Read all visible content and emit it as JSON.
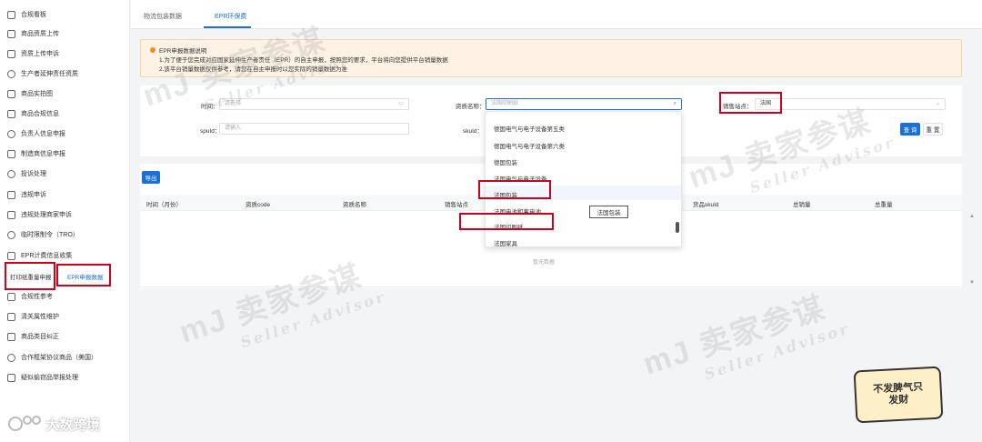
{
  "sidebar": {
    "items": [
      {
        "label": "合规看板",
        "icon": "dashboard-icon"
      },
      {
        "label": "商品资质上传",
        "icon": "upload-icon"
      },
      {
        "label": "资质上传申诉",
        "icon": "appeal-icon"
      },
      {
        "label": "生产者延伸责任资质",
        "icon": "producer-icon"
      },
      {
        "label": "商品实拍图",
        "icon": "photo-icon"
      },
      {
        "label": "商品合规信息",
        "icon": "info-icon"
      },
      {
        "label": "负责人信息申报",
        "icon": "person-icon"
      },
      {
        "label": "制造商信息申报",
        "icon": "factory-icon"
      },
      {
        "label": "投诉处理",
        "icon": "complaint-icon"
      },
      {
        "label": "违规申诉",
        "icon": "violation-icon"
      },
      {
        "label": "违规处理商家申诉",
        "icon": "merchant-appeal-icon"
      },
      {
        "label": "临时限制令（TRO）",
        "icon": "clock-icon"
      },
      {
        "label": "EPR计费信息收集",
        "icon": "epr-icon"
      },
      {
        "label": "合规性参考",
        "icon": "reference-icon"
      },
      {
        "label": "清关属性维护",
        "icon": "customs-icon"
      },
      {
        "label": "商品类目纠正",
        "icon": "category-icon"
      },
      {
        "label": "合作框架协议商品（美国）",
        "icon": "agreement-icon"
      },
      {
        "label": "疑似偷窃品举报处理",
        "icon": "report-icon"
      }
    ],
    "sub_items": {
      "print_paper": "打印纸重量申报",
      "epr_data": "EPR申报数据"
    },
    "brand": "大数跨境"
  },
  "tabs": [
    {
      "label": "物流包装数据"
    },
    {
      "label": "EPR环保费"
    }
  ],
  "notice": {
    "title": "EPR申报数据说明",
    "line1": "1.为了便于您完成对应国家延伸生产者责任（EPR）的自主申报，按照您的要求，平台将向您提供平台销量数据",
    "line2": "2.该平台销量数据仅供参考，请您在自主申报时以您实际的销量数据为准"
  },
  "filters": {
    "time_label": "时间：",
    "time_placeholder": "请选择",
    "qual_label": "资质名称：",
    "qual_placeholder": "法国印刷纸",
    "site_label": "销售站点：",
    "site_value": "法国",
    "spuid_label": "spuId：",
    "spuid_placeholder": "请输入",
    "skuid_label": "skuId：",
    "search_btn": "查 询",
    "reset_btn": "重 置"
  },
  "export_btn": "导出",
  "table": {
    "headers": [
      "时间（月份）",
      "资质code",
      "资质名称",
      "销售站点",
      "货品skuId",
      "总销量",
      "总重量"
    ],
    "empty_text": "暂无数据"
  },
  "dropdown": {
    "options": [
      "德国电气与电子设备第五类",
      "德国电气与电子设备第六类",
      "德国包装",
      "法国电气与电子设备",
      "法国包装",
      "法国电池和蓄电池",
      "法国印刷纸",
      "法国家具"
    ]
  },
  "tooltip": "法国包装",
  "watermark": {
    "main": "卖家参谋",
    "sub": "Seller Advisor"
  },
  "sticker": "不发脾气只发财",
  "colors": {
    "accent": "#1a6fd8",
    "highlight_box": "#d0021b",
    "notice_bg": "#fdf2e4"
  }
}
